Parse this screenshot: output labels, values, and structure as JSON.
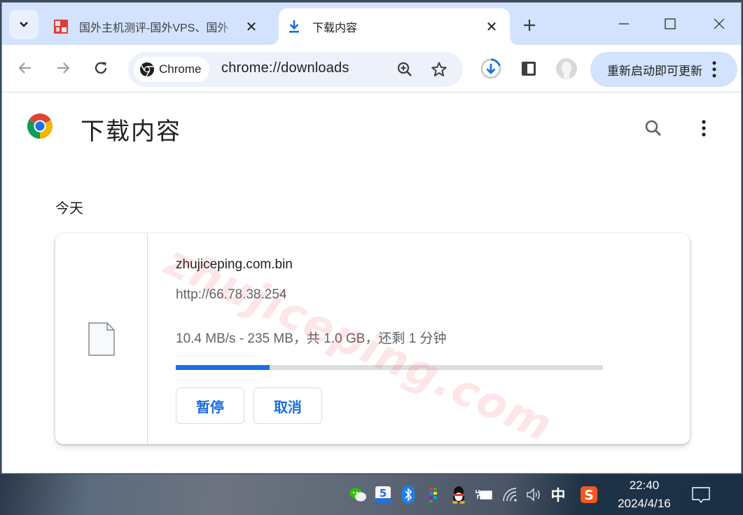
{
  "browser": {
    "tabs": [
      {
        "title": "国外主机测评-国外VPS、国外",
        "favicon": "site-seal-icon",
        "active": false
      },
      {
        "title": "下载内容",
        "favicon": "download-icon",
        "active": true
      }
    ],
    "new_tab": "+",
    "toolbar": {
      "chip_label": "Chrome",
      "url": "chrome://downloads",
      "update_button": "重新启动即可更新"
    },
    "colors": {
      "tabstrip": "#d3e3fd",
      "omnibox": "#edf2fa",
      "accent": "#1b6fe0"
    }
  },
  "page": {
    "title": "下载内容",
    "section_heading": "今天",
    "downloads": [
      {
        "file_name": "zhujiceping.com.bin",
        "source_url": "http://66.78.38.254",
        "status": "10.4 MB/s - 235 MB，共 1.0 GB，还剩 1 分钟",
        "progress_fraction": 0.22,
        "buttons": {
          "pause": "暂停",
          "cancel": "取消"
        }
      }
    ],
    "watermark": "zhujiceping.com"
  },
  "taskbar": {
    "tray_icons": [
      "wechat-icon",
      "5-app-icon",
      "bluetooth-icon",
      "colorful-app-icon",
      "qq-icon",
      "power-battery-icon",
      "wifi-icon",
      "volume-icon",
      "ime-icon",
      "sogou-icon"
    ],
    "ime_label": "中",
    "time": "22:40",
    "date": "2024/4/16"
  }
}
